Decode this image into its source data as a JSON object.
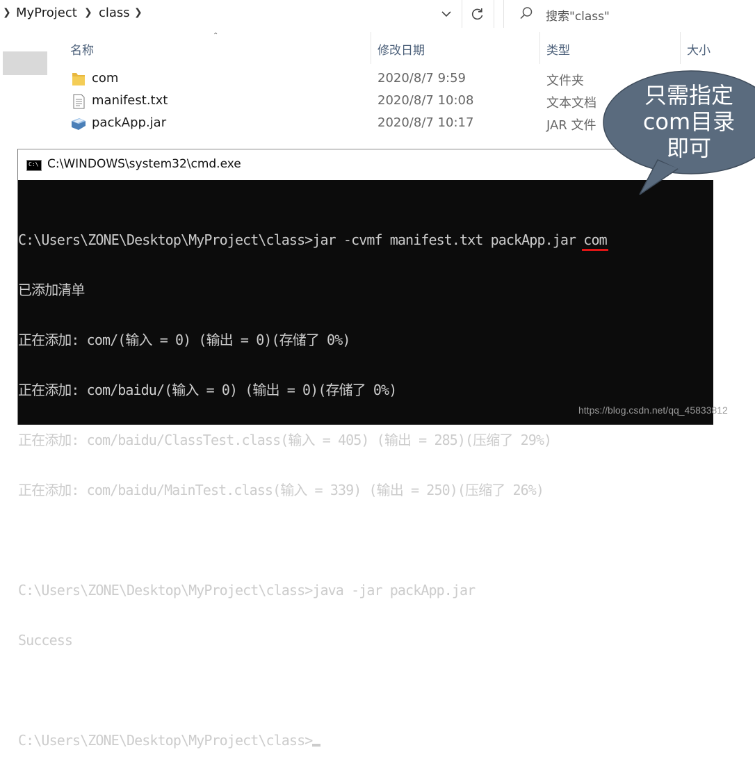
{
  "explorer": {
    "breadcrumb": [
      "MyProject",
      "class"
    ],
    "search_placeholder": "搜索\"class\"",
    "columns": {
      "name": "名称",
      "date": "修改日期",
      "type": "类型",
      "size": "大小"
    },
    "files": [
      {
        "name": "com",
        "date": "2020/8/7 9:59",
        "type": "文件夹",
        "icon": "folder-icon"
      },
      {
        "name": "manifest.txt",
        "date": "2020/8/7 10:08",
        "type": "文本文档",
        "icon": "text-file-icon"
      },
      {
        "name": "packApp.jar",
        "date": "2020/8/7 10:17",
        "type": "JAR 文件",
        "icon": "jar-file-icon"
      }
    ]
  },
  "cmd": {
    "title": "C:\\WINDOWS\\system32\\cmd.exe",
    "lines": {
      "l1_prompt": "C:\\Users\\ZONE\\Desktop\\MyProject\\class>jar -cvmf manifest.txt packApp.jar ",
      "l1_highlight": "com",
      "l2": "已添加清单",
      "l3": "正在添加: com/(输入 = 0) (输出 = 0)(存储了 0%)",
      "l4": "正在添加: com/baidu/(输入 = 0) (输出 = 0)(存储了 0%)",
      "l5": "正在添加: com/baidu/ClassTest.class(输入 = 405) (输出 = 285)(压缩了 29%)",
      "l6": "正在添加: com/baidu/MainTest.class(输入 = 339) (输出 = 250)(压缩了 26%)",
      "l7": "C:\\Users\\ZONE\\Desktop\\MyProject\\class>java -jar packApp.jar",
      "l8": "Success",
      "l9": "C:\\Users\\ZONE\\Desktop\\MyProject\\class>"
    },
    "colors": {
      "background": "#0c0c0c",
      "text": "#cccccc",
      "highlight_underline": "#e01515"
    }
  },
  "callout": {
    "lines": [
      "只需指定",
      "com目录",
      "即可"
    ],
    "fill": "#5a6b7e"
  },
  "watermark": "https://blog.csdn.net/qq_45833812"
}
